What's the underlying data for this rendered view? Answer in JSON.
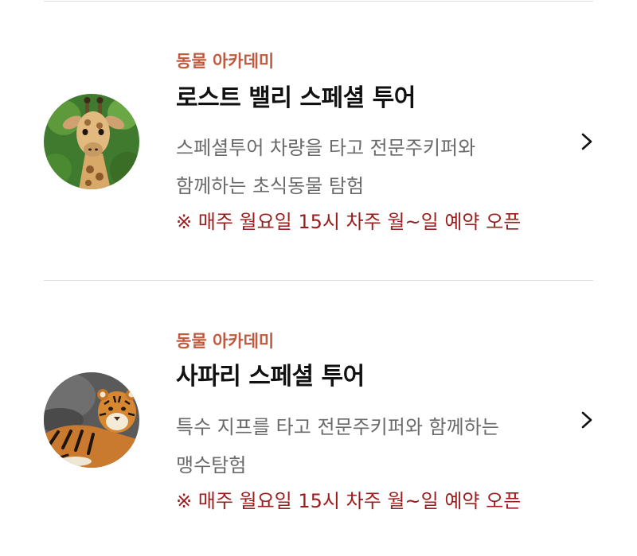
{
  "tours": [
    {
      "category": "동물 아카데미",
      "title": "로스트 밸리 스페셜 투어",
      "desc_line1": "스페셜투어 차량을 타고 전문주키퍼와",
      "desc_line2": "함께하는 초식동물 탐험",
      "notice": "※ 매주 월요일 15시 차주 월~일 예약 오픈",
      "image": "giraffe"
    },
    {
      "category": "동물 아카데미",
      "title": "사파리 스페셜 투어",
      "desc_line1": "특수 지프를 타고 전문주키퍼와 함께하는",
      "desc_line2": "맹수탐험",
      "notice": "※ 매주 월요일 15시 차주 월~일 예약 오픈",
      "image": "tiger"
    }
  ],
  "icons": {
    "chevron": "chevron-right-icon"
  },
  "colors": {
    "category": "#c05a3e",
    "notice": "#9c1c1c",
    "title": "#111111",
    "desc": "#6a6a6a",
    "divider": "#dedede"
  }
}
